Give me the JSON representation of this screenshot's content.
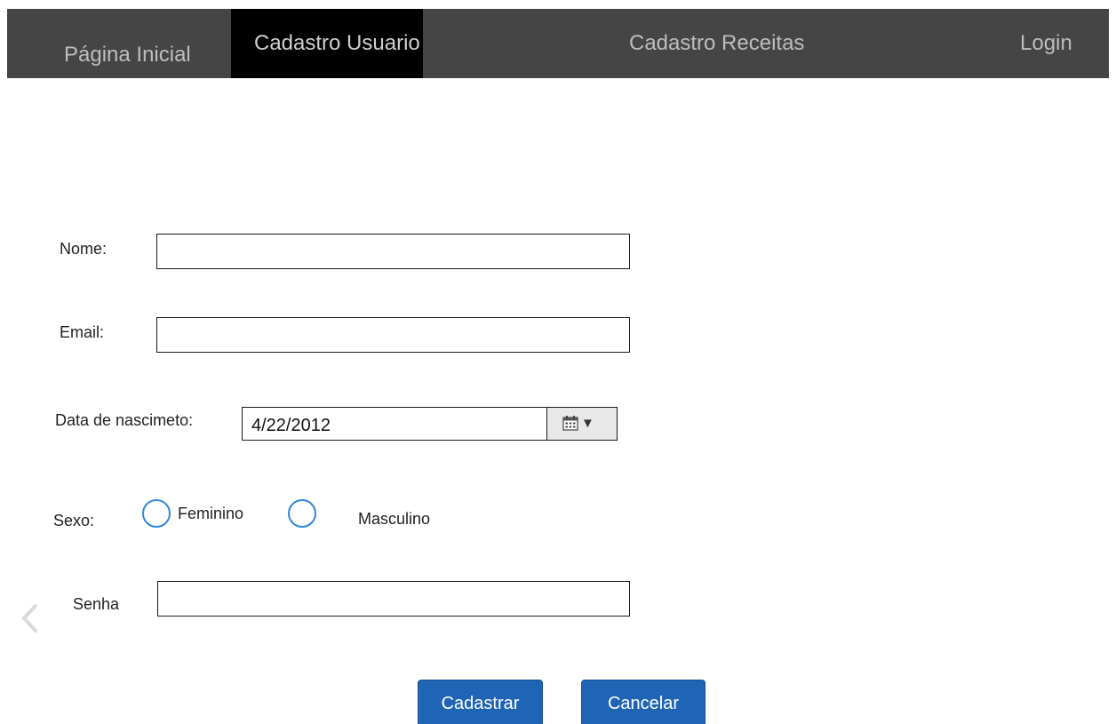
{
  "nav": {
    "items": [
      {
        "label": "Página Inicial",
        "active": false
      },
      {
        "label": "Cadastro Usuario",
        "active": true
      },
      {
        "label": "Cadastro Receitas",
        "active": false
      },
      {
        "label": "Login",
        "active": false
      }
    ],
    "background": "#454545",
    "active_background": "#000000"
  },
  "form": {
    "name_label": "Nome:",
    "name_value": "",
    "email_label": "Email:",
    "email_value": "",
    "birth_label": "Data de nascimeto:",
    "birth_value": "4/22/2012",
    "birth_icons": [
      "calendar-icon",
      "caret-down-icon"
    ],
    "sex_label": "Sexo:",
    "sex_options": [
      "Feminino",
      "Masculino"
    ],
    "sex_selected": null,
    "password_label": "Senha",
    "password_value": ""
  },
  "buttons": {
    "submit": "Cadastrar",
    "cancel": "Cancelar",
    "color": "#1f64b5"
  },
  "icons": {
    "back": "chevron-left-icon"
  },
  "colors": {
    "radio_border": "#2f86de"
  }
}
